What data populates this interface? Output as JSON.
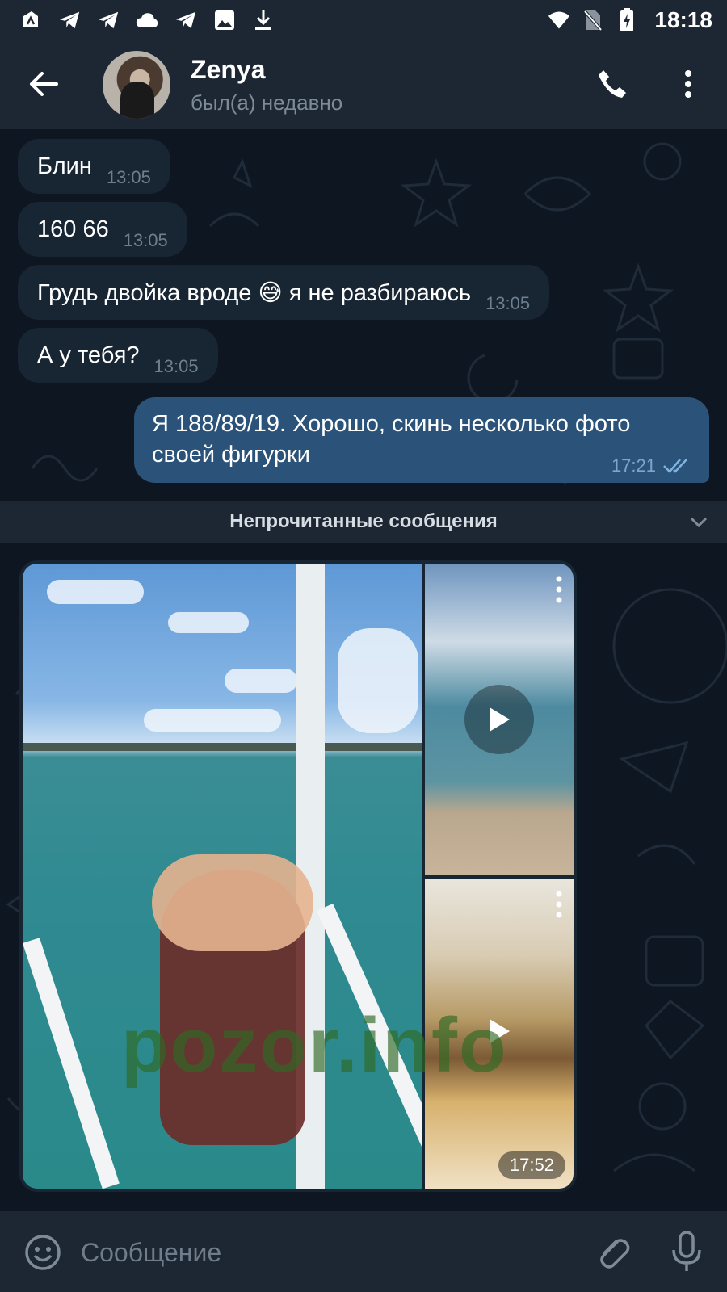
{
  "status_bar": {
    "time": "18:18",
    "left_icons": [
      "app-icon",
      "telegram-icon",
      "telegram-icon",
      "cloud-icon",
      "telegram-icon",
      "image-icon",
      "download-icon"
    ],
    "right_icons": [
      "wifi-icon",
      "no-sim-icon",
      "battery-charging-icon"
    ]
  },
  "header": {
    "name": "Zenya",
    "status": "был(а) недавно"
  },
  "messages": {
    "incoming": [
      {
        "text": "Блин",
        "time": "13:05"
      },
      {
        "text": "160 66",
        "time": "13:05"
      },
      {
        "text": "Грудь двойка вроде 😅 я не разбираюсь",
        "time": "13:05"
      },
      {
        "text": "А у тебя?",
        "time": "13:05"
      }
    ],
    "outgoing": {
      "text": "Я 188/89/19. Хорошо, скинь несколько фото своей фигурки",
      "time": "17:21",
      "status": "read"
    }
  },
  "unread_divider": "Непрочитанные сообщения",
  "media_group": {
    "items": [
      "photo",
      "video",
      "video"
    ],
    "duration": "17:52",
    "watermark": "pozor.info"
  },
  "input": {
    "placeholder": "Сообщение"
  },
  "colors": {
    "header_bg": "#1d2733",
    "chat_bg": "#0e1621",
    "incoming_bubble": "#182533",
    "outgoing_bubble": "#2b5278",
    "accent": "#64b5ef"
  }
}
